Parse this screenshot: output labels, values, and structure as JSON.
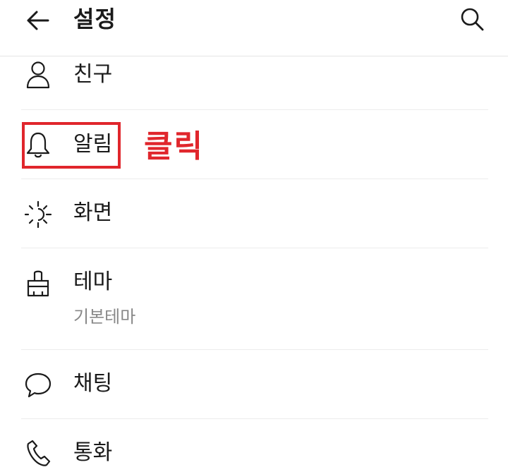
{
  "header": {
    "title": "설정",
    "back_icon": "arrow-left-icon",
    "search_icon": "search-icon"
  },
  "settings": {
    "items": [
      {
        "label": "친구",
        "icon": "person-icon"
      },
      {
        "label": "알림",
        "icon": "bell-icon"
      },
      {
        "label": "화면",
        "icon": "brightness-icon"
      },
      {
        "label": "테마",
        "sublabel": "기본테마",
        "icon": "paint-brush-icon"
      },
      {
        "label": "채팅",
        "icon": "chat-bubble-icon"
      },
      {
        "label": "통화",
        "icon": "phone-icon"
      }
    ]
  },
  "annotation": {
    "text": "클릭",
    "color": "#e0262c"
  }
}
